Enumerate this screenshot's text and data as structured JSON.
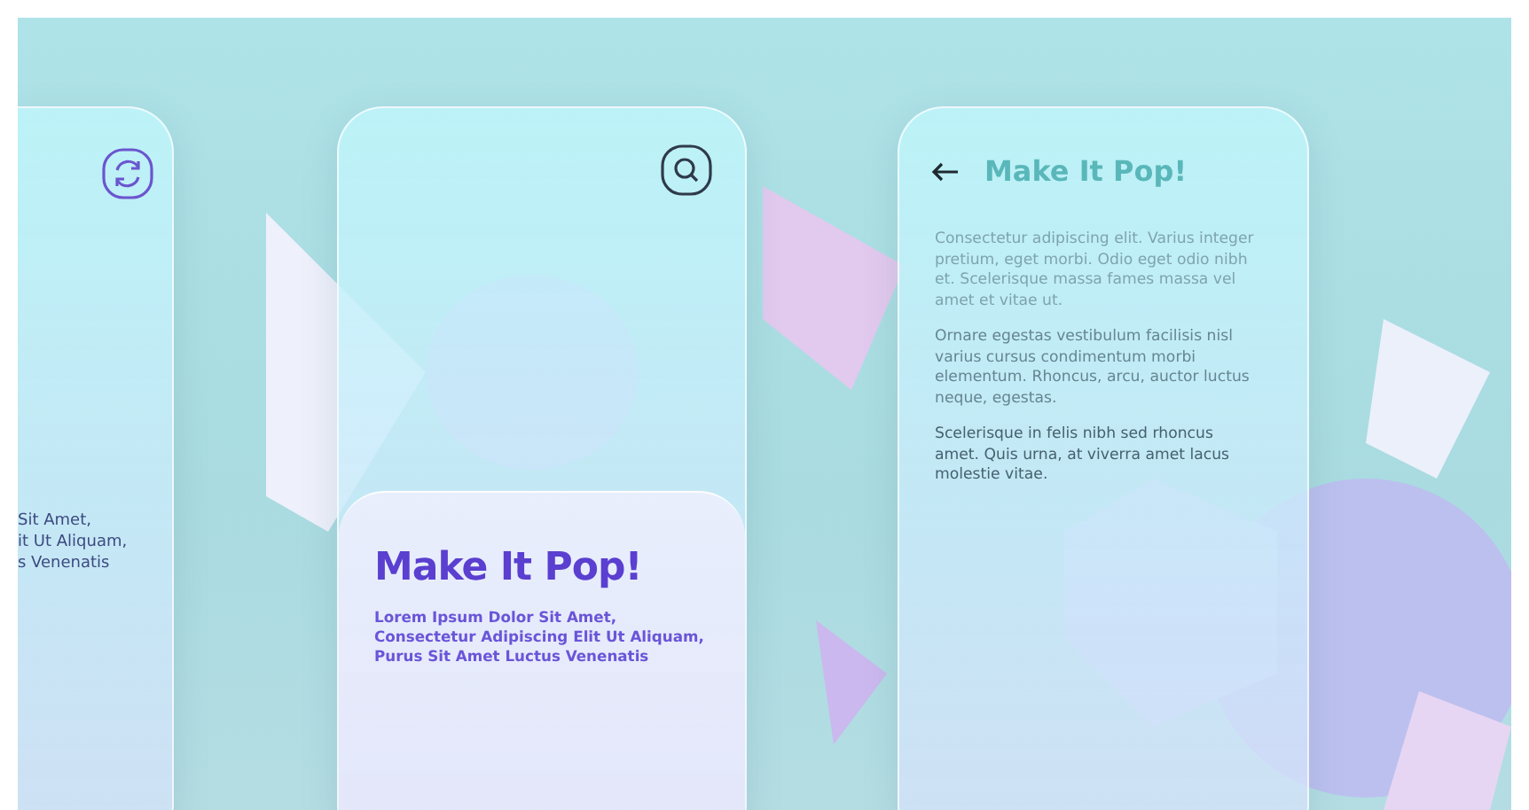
{
  "left_card": {
    "lines": [
      "Sit Amet,",
      "it Ut Aliquam,",
      "s Venenatis"
    ]
  },
  "center_card": {
    "title": "Make It Pop!",
    "body": "Lorem Ipsum Dolor Sit Amet, Consectetur Adipiscing Elit Ut Aliquam, Purus Sit Amet Luctus Venenatis"
  },
  "right_card": {
    "title": "Make It Pop!",
    "paragraphs": [
      "Consectetur adipiscing elit. Varius integer pretium, eget morbi. Odio eget odio nibh et. Scelerisque massa fames massa vel amet et vitae ut.",
      "Ornare egestas vestibulum facilisis nisl varius cursus condimentum morbi elementum. Rhoncus, arcu, auctor luctus neque, egestas.",
      "Scelerisque in felis nibh sed rhoncus amet. Quis urna, at viverra amet lacus molestie vitae."
    ]
  }
}
